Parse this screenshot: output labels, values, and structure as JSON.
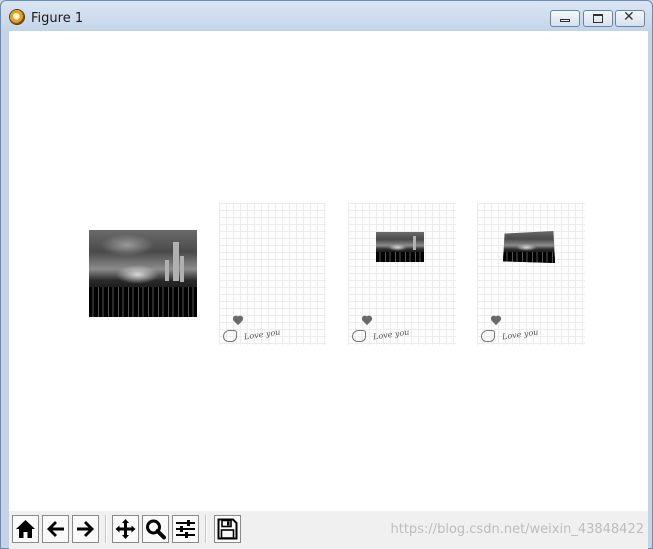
{
  "window": {
    "title": "Figure 1"
  },
  "canvas": {
    "thumbnails": [
      {
        "kind": "photo"
      },
      {
        "kind": "grid",
        "text": "Love you"
      },
      {
        "kind": "grid-with-photo",
        "text": "Love you"
      },
      {
        "kind": "grid-with-warped-photo",
        "text": "Love you"
      }
    ]
  },
  "toolbar": {
    "buttons": [
      {
        "name": "home",
        "icon": "home-icon"
      },
      {
        "name": "back",
        "icon": "arrow-left-icon"
      },
      {
        "name": "forward",
        "icon": "arrow-right-icon"
      },
      {
        "name": "pan",
        "icon": "move-icon"
      },
      {
        "name": "zoom",
        "icon": "magnifier-icon"
      },
      {
        "name": "configure",
        "icon": "sliders-icon"
      },
      {
        "name": "save",
        "icon": "floppy-disk-icon"
      }
    ],
    "watermark": "https://blog.csdn.net/weixin_43848422"
  },
  "colors": {
    "window_frame": "#c4d4e8",
    "canvas": "#ffffff",
    "toolbar": "#f0f0f0"
  }
}
